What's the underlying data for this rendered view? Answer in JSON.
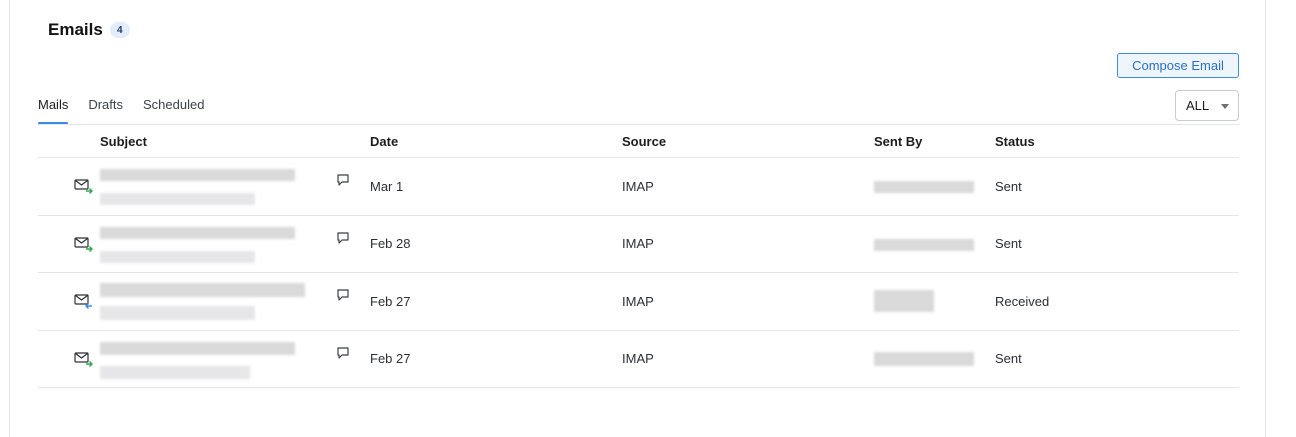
{
  "header": {
    "title": "Emails",
    "count": "4"
  },
  "actions": {
    "compose_label": "Compose Email"
  },
  "tabs": [
    {
      "label": "Mails",
      "active": true
    },
    {
      "label": "Drafts",
      "active": false
    },
    {
      "label": "Scheduled",
      "active": false
    }
  ],
  "filter": {
    "selected": "ALL"
  },
  "table": {
    "columns": [
      "Subject",
      "Date",
      "Source",
      "Sent By",
      "Status"
    ],
    "rows": [
      {
        "direction": "outgoing",
        "date": "Mar 1",
        "source": "IMAP",
        "status": "Sent"
      },
      {
        "direction": "outgoing",
        "date": "Feb 28",
        "source": "IMAP",
        "status": "Sent"
      },
      {
        "direction": "incoming",
        "date": "Feb 27",
        "source": "IMAP",
        "status": "Received"
      },
      {
        "direction": "outgoing",
        "date": "Feb 27",
        "source": "IMAP",
        "status": "Sent"
      }
    ]
  },
  "icons": {
    "mail_outgoing": "mail-sent-icon",
    "mail_incoming": "mail-received-icon",
    "comment": "comment-icon",
    "dropdown": "chevron-down-icon"
  },
  "colors": {
    "accent": "#3b8be5",
    "outgoing_arrow": "#2fa84f",
    "incoming_arrow": "#3b8be5"
  }
}
